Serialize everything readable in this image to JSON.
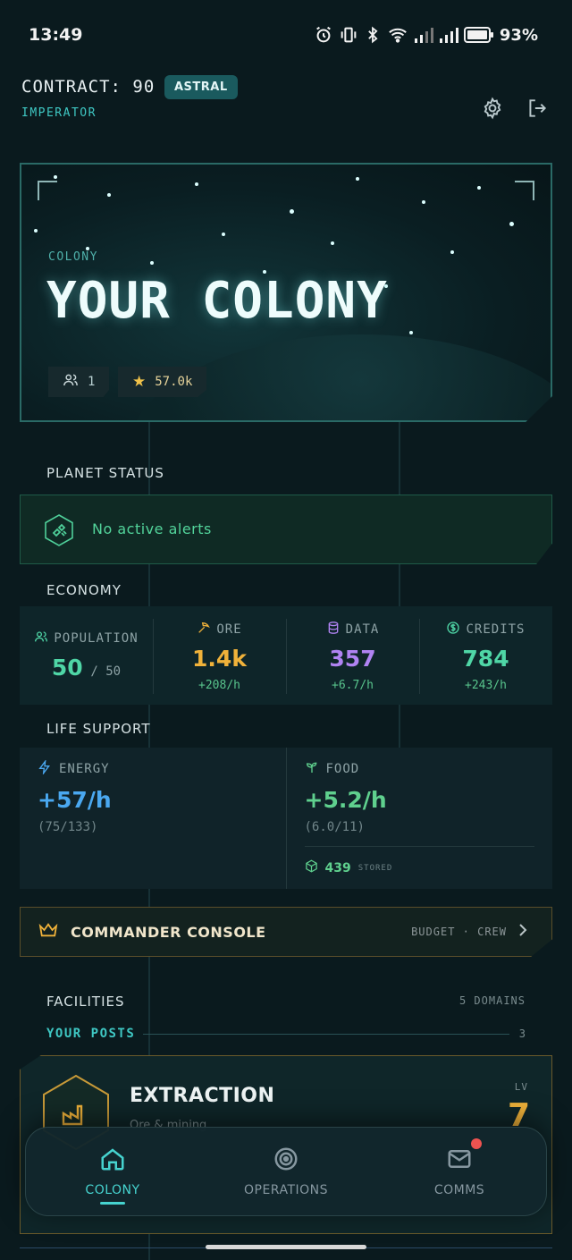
{
  "status_bar": {
    "time": "13:49",
    "battery": "93%"
  },
  "header": {
    "contract_label": "CONTRACT: 90",
    "badge": "ASTRAL",
    "rank": "IMPERATOR"
  },
  "hero": {
    "subtitle": "COLONY",
    "title": "YOUR COLONY",
    "members": "1",
    "stars": "57.0k"
  },
  "planet_status": {
    "heading": "PLANET STATUS",
    "alert_text": "No active alerts"
  },
  "economy": {
    "heading": "ECONOMY",
    "population": {
      "label": "POPULATION",
      "value": "50",
      "max": "/ 50"
    },
    "ore": {
      "label": "ORE",
      "value": "1.4k",
      "rate": "+208/h",
      "color": "#f0b23a"
    },
    "data": {
      "label": "DATA",
      "value": "357",
      "rate": "+6.7/h",
      "color": "#b083f2"
    },
    "credits": {
      "label": "CREDITS",
      "value": "784",
      "rate": "+243/h",
      "color": "#4fd6a6"
    }
  },
  "life_support": {
    "heading": "LIFE SUPPORT",
    "energy": {
      "label": "ENERGY",
      "value": "+57/h",
      "sub": "(75/133)"
    },
    "food": {
      "label": "FOOD",
      "value": "+5.2/h",
      "sub": "(6.0/11)",
      "stored_value": "439",
      "stored_label": "STORED"
    }
  },
  "console": {
    "title": "COMMANDER CONSOLE",
    "meta": "BUDGET · CREW"
  },
  "facilities": {
    "heading": "FACILITIES",
    "count": "5 DOMAINS",
    "posts_label": "YOUR POSTS",
    "posts_count": "3",
    "items": [
      {
        "name": "EXTRACTION",
        "sub": "Ore & mining",
        "lv_label": "LV",
        "level": "7"
      }
    ]
  },
  "nav": [
    {
      "label": "COLONY",
      "icon": "home-icon",
      "active": true
    },
    {
      "label": "OPERATIONS",
      "icon": "target-icon",
      "active": false
    },
    {
      "label": "COMMS",
      "icon": "mail-icon",
      "active": false
    }
  ]
}
